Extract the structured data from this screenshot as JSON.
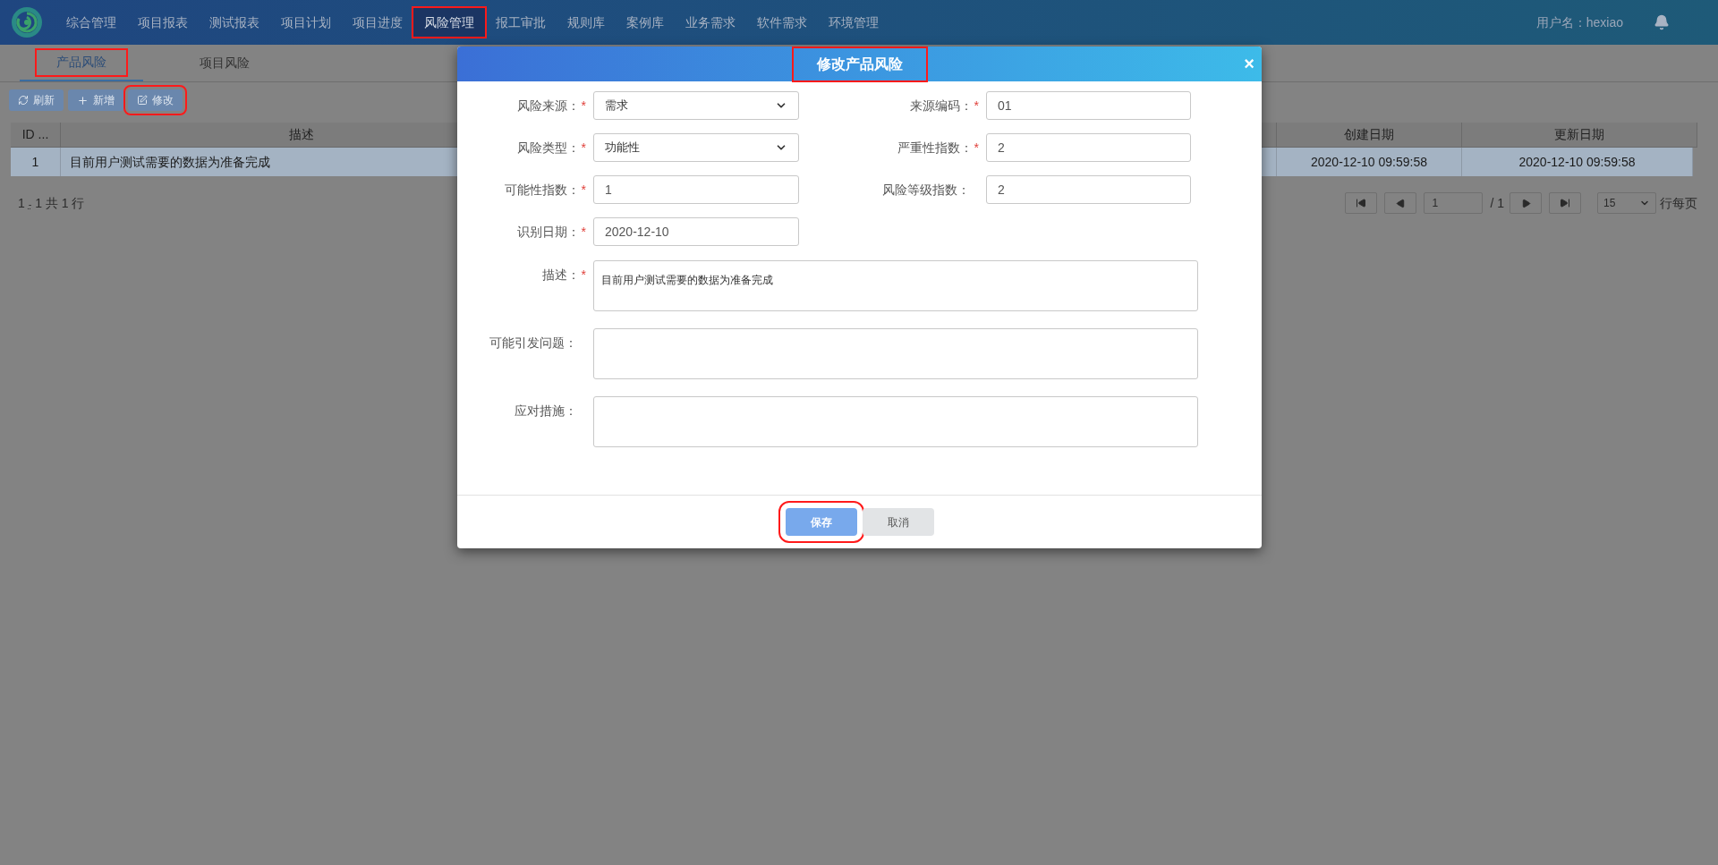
{
  "nav": {
    "items": [
      {
        "label": "综合管理",
        "selected": false,
        "highlighted": false
      },
      {
        "label": "项目报表",
        "selected": false,
        "highlighted": false
      },
      {
        "label": "测试报表",
        "selected": false,
        "highlighted": false
      },
      {
        "label": "项目计划",
        "selected": false,
        "highlighted": false
      },
      {
        "label": "项目进度",
        "selected": false,
        "highlighted": false
      },
      {
        "label": "风险管理",
        "selected": true,
        "highlighted": true
      },
      {
        "label": "报工审批",
        "selected": false,
        "highlighted": false
      },
      {
        "label": "规则库",
        "selected": false,
        "highlighted": false
      },
      {
        "label": "案例库",
        "selected": false,
        "highlighted": false
      },
      {
        "label": "业务需求",
        "selected": false,
        "highlighted": false
      },
      {
        "label": "软件需求",
        "selected": false,
        "highlighted": false
      },
      {
        "label": "环境管理",
        "selected": false,
        "highlighted": false
      }
    ],
    "user_label": "用户名：hexiao"
  },
  "subtabs": [
    {
      "label": "产品风险",
      "selected": true,
      "highlighted": true
    },
    {
      "label": "项目风险",
      "selected": false,
      "highlighted": false
    }
  ],
  "toolbar": [
    {
      "label": "刷新",
      "kind": "refresh",
      "highlighted": false
    },
    {
      "label": "新增",
      "kind": "add",
      "highlighted": false
    },
    {
      "label": "修改",
      "kind": "edit",
      "highlighted": true
    }
  ],
  "table": {
    "columns": [
      "ID ...",
      "描述",
      "创建日期",
      "更新日期"
    ],
    "rows": [
      {
        "selected": true,
        "cells": [
          "1",
          "目前用户测试需要的数据为准备完成",
          "2020-12-10 09:59:58",
          "2020-12-10 09:59:58"
        ]
      }
    ]
  },
  "pagination": {
    "summary_start": "1",
    "summary_dash": "-",
    "summary_rest": "1 共 1 行",
    "page": "1",
    "total": "/ 1",
    "page_size": "15",
    "page_size_label": "行每页"
  },
  "dialog": {
    "title": "修改产品风险",
    "title_highlighted": true,
    "close": "×",
    "grid_rows": [
      [
        {
          "label": "风险来源：",
          "required_mark": "*",
          "kind": "select",
          "value": "需求"
        },
        {
          "label": "来源编码：",
          "required_mark": "*",
          "kind": "input",
          "value": "01"
        }
      ],
      [
        {
          "label": "风险类型：",
          "required_mark": "*",
          "kind": "select",
          "value": "功能性"
        },
        {
          "label": "严重性指数：",
          "required_mark": "*",
          "kind": "input",
          "value": "2"
        }
      ],
      [
        {
          "label": "可能性指数：",
          "required_mark": "*",
          "kind": "input",
          "value": "1"
        },
        {
          "label": "风险等级指数：",
          "kind": "input",
          "value": "2"
        }
      ],
      [
        {
          "label": "识别日期：",
          "required_mark": "*",
          "kind": "input",
          "value": "2020-12-10"
        }
      ]
    ],
    "text_areas": [
      {
        "label": "描述：",
        "required_mark": "*",
        "value": "目前用户测试需要的数据为准备完成"
      },
      {
        "label": "可能引发问题："
      },
      {
        "label": "应对措施："
      }
    ],
    "buttons": [
      {
        "label": "保存",
        "kind": "primary",
        "highlighted": true
      },
      {
        "label": "取消",
        "kind": "secondary",
        "highlighted": false
      }
    ]
  }
}
